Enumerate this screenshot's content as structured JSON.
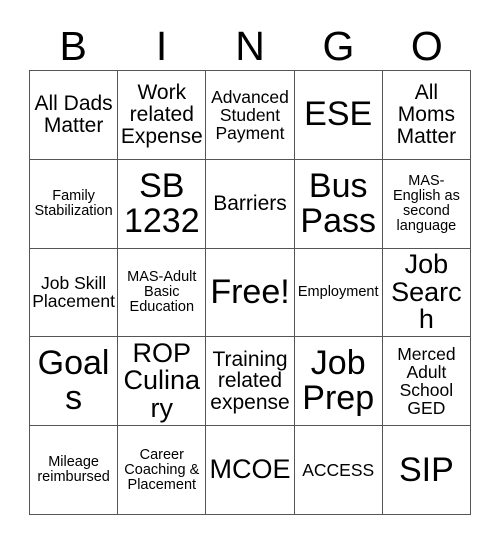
{
  "card": {
    "title": "BINGO Card",
    "header_letters": [
      "B",
      "I",
      "N",
      "G",
      "O"
    ],
    "border_color": "#555555",
    "text_color": "#000000",
    "background_color": "#ffffff",
    "rows": [
      [
        {
          "text": "All Dads Matter",
          "size": "lg"
        },
        {
          "text": "Work related Expense",
          "size": "lg"
        },
        {
          "text": "Advanced Student Payment",
          "size": "md"
        },
        {
          "text": "ESE",
          "size": "xxl"
        },
        {
          "text": "All Moms Matter",
          "size": "lg"
        }
      ],
      [
        {
          "text": "Family Stabilization",
          "size": "sm"
        },
        {
          "text": "SB 1232",
          "size": "xxl"
        },
        {
          "text": "Barriers",
          "size": "lg"
        },
        {
          "text": "Bus Pass",
          "size": "xxl"
        },
        {
          "text": "MAS-English as second language",
          "size": "sm"
        }
      ],
      [
        {
          "text": "Job Skill Placement",
          "size": "md"
        },
        {
          "text": "MAS-Adult Basic Education",
          "size": "sm"
        },
        {
          "text": "Free!",
          "size": "xxl"
        },
        {
          "text": "Employment",
          "size": "sm"
        },
        {
          "text": "Job Search",
          "size": "xl"
        }
      ],
      [
        {
          "text": "Goals",
          "size": "xxl"
        },
        {
          "text": "ROP Culinary",
          "size": "xl"
        },
        {
          "text": "Training related expense",
          "size": "lg"
        },
        {
          "text": "Job Prep",
          "size": "xxl"
        },
        {
          "text": "Merced Adult School GED",
          "size": "md"
        }
      ],
      [
        {
          "text": "Mileage reimbursed",
          "size": "sm"
        },
        {
          "text": "Career Coaching & Placement",
          "size": "sm"
        },
        {
          "text": "MCOE",
          "size": "xl"
        },
        {
          "text": "ACCESS",
          "size": "md"
        },
        {
          "text": "SIP",
          "size": "xxl"
        }
      ]
    ]
  }
}
